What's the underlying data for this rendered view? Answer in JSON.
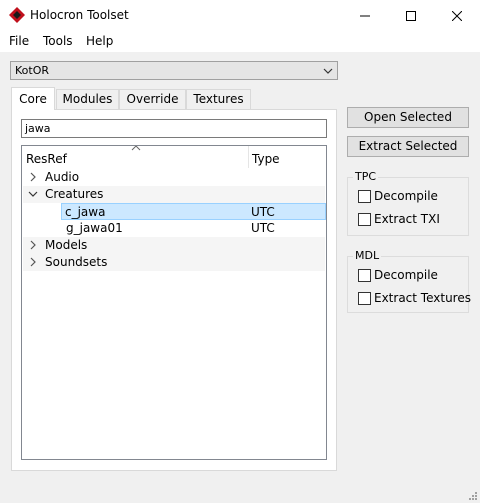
{
  "window": {
    "title": "Holocron Toolset",
    "logo_icon": "holocron-diamond-icon",
    "accent_color": "#c0101c",
    "controls": [
      "minimize-icon",
      "maximize-icon",
      "close-icon"
    ]
  },
  "menubar": {
    "items": [
      "File",
      "Tools",
      "Help"
    ]
  },
  "game_select": {
    "value": "KotOR",
    "icon": "chevron-down-icon"
  },
  "tabs": [
    {
      "label": "Core",
      "active": true
    },
    {
      "label": "Modules",
      "active": false
    },
    {
      "label": "Override",
      "active": false
    },
    {
      "label": "Textures",
      "active": false
    }
  ],
  "search": {
    "value": "jawa"
  },
  "tree": {
    "columns": [
      "ResRef",
      "Type"
    ],
    "rows": [
      {
        "label": "Audio",
        "type": "",
        "expanded": false
      },
      {
        "label": "Creatures",
        "type": "",
        "expanded": true
      },
      {
        "label": "c_jawa",
        "type": "UTC",
        "selected": true
      },
      {
        "label": "g_jawa01",
        "type": "UTC"
      },
      {
        "label": "Models",
        "type": "",
        "expanded": false
      },
      {
        "label": "Soundsets",
        "type": "",
        "expanded": false
      }
    ]
  },
  "actions": {
    "open_label": "Open Selected",
    "extract_label": "Extract Selected"
  },
  "tpc": {
    "title": "TPC",
    "decompile_label": "Decompile",
    "extract_txi_label": "Extract TXI"
  },
  "mdl": {
    "title": "MDL",
    "decompile_label": "Decompile",
    "extract_textures_label": "Extract Textures"
  }
}
